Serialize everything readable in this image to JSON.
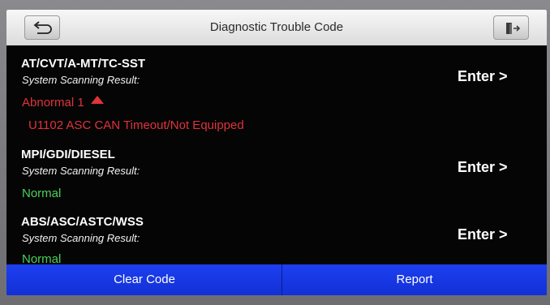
{
  "header": {
    "title": "Diagnostic Trouble Code",
    "back_icon": "back-arrow-icon",
    "exit_icon": "exit-door-icon"
  },
  "systems": [
    {
      "name": "AT/CVT/A-MT/TC-SST",
      "result_label": "System Scanning Result:",
      "status": "Abnormal 1",
      "status_color": "#e0333a",
      "enter_label": "Enter >",
      "codes": [
        "U1102 ASC CAN Timeout/Not Equipped"
      ]
    },
    {
      "name": "MPI/GDI/DIESEL",
      "result_label": "System Scanning Result:",
      "status": "Normal",
      "status_color": "#4ccf58",
      "enter_label": "Enter >"
    },
    {
      "name": "ABS/ASC/ASTC/WSS",
      "result_label": "System Scanning Result:",
      "status": "Normal",
      "status_color": "#4ccf58",
      "enter_label": "Enter >"
    }
  ],
  "footer": {
    "clear_label": "Clear Code",
    "report_label": "Report",
    "accent": "#1a38e8"
  }
}
